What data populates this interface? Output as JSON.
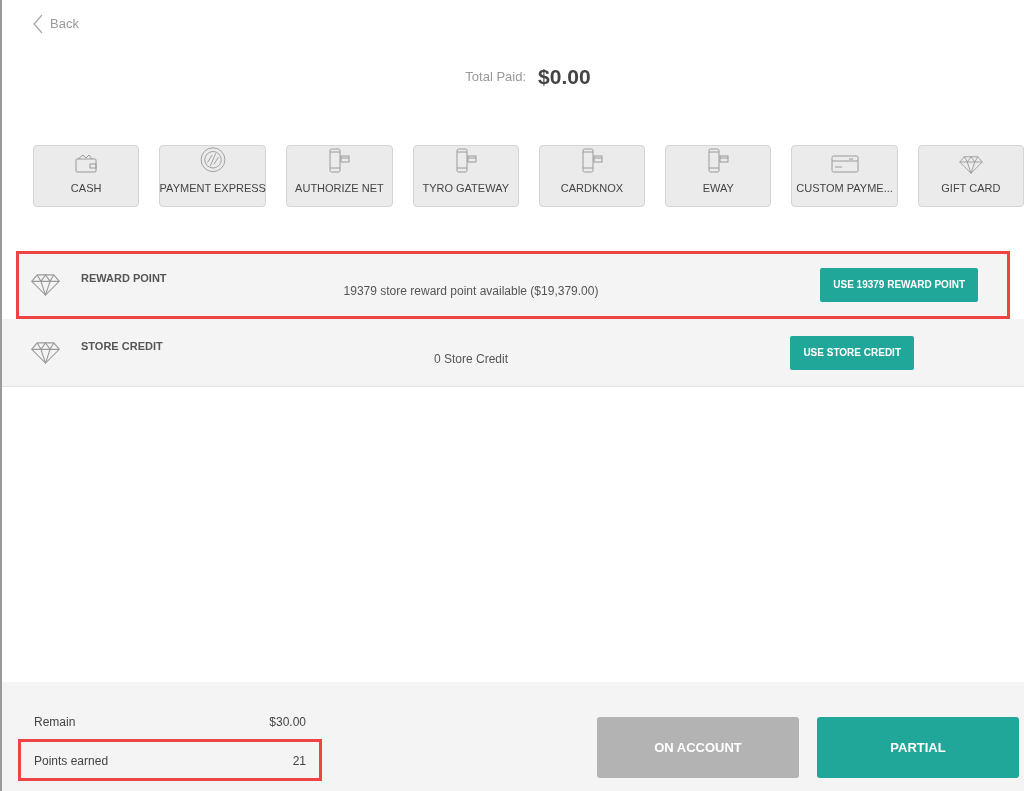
{
  "back": {
    "label": "Back"
  },
  "total_paid": {
    "label": "Total Paid:",
    "amount": "$0.00"
  },
  "payment_methods": [
    {
      "label": "CASH",
      "kind": "wallet"
    },
    {
      "label": "PAYMENT EXPRESS",
      "kind": "contactless"
    },
    {
      "label": "AUTHORIZE NET",
      "kind": "phone"
    },
    {
      "label": "TYRO GATEWAY",
      "kind": "phone"
    },
    {
      "label": "CARDKNOX",
      "kind": "phone"
    },
    {
      "label": "EWAY",
      "kind": "phone"
    },
    {
      "label": "CUSTOM PAYME...",
      "kind": "card"
    },
    {
      "label": "GIFT CARD",
      "kind": "diamond"
    }
  ],
  "balances": [
    {
      "name": "REWARD POINT",
      "info": "19379 store reward point available ($19,379.00)",
      "button": "USE 19379 REWARD POINT",
      "highlighted": true
    },
    {
      "name": "STORE CREDIT",
      "info": "0 Store Credit",
      "button": "USE STORE CREDIT",
      "highlighted": false
    }
  ],
  "summary": [
    {
      "label": "Remain",
      "value": "$30.00",
      "highlighted": false
    },
    {
      "label": "Points earned",
      "value": "21",
      "highlighted": true
    }
  ],
  "actions": [
    {
      "label": "ON ACCOUNT",
      "disabled": true
    },
    {
      "label": "PARTIAL",
      "disabled": false
    }
  ]
}
